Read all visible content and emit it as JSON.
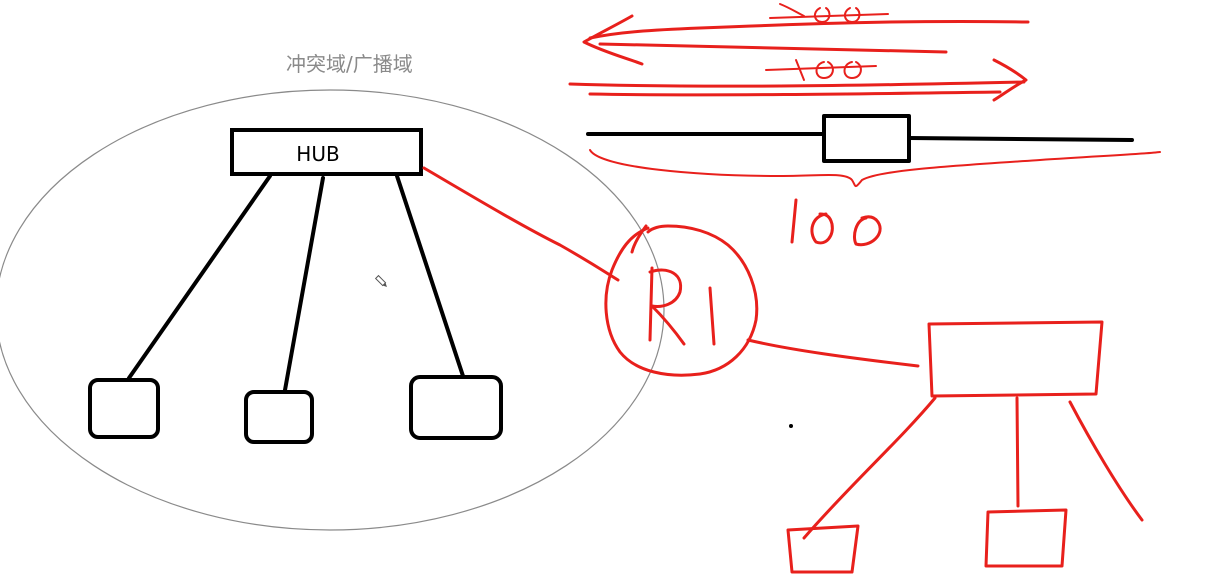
{
  "diagram": {
    "caption": "冲突域/广播域",
    "hub_label": "HUB",
    "router_label": "R1",
    "bandwidth_label": "100",
    "arrow_label_top": "100",
    "arrow_label_bottom": "100"
  },
  "colors": {
    "ink_black": "#000000",
    "ink_red": "#e8201c",
    "ellipse_gray": "#8a8a8a",
    "caption_gray": "#8a8a8a"
  },
  "icons": {
    "cursor": "pencil-cursor-icon"
  }
}
